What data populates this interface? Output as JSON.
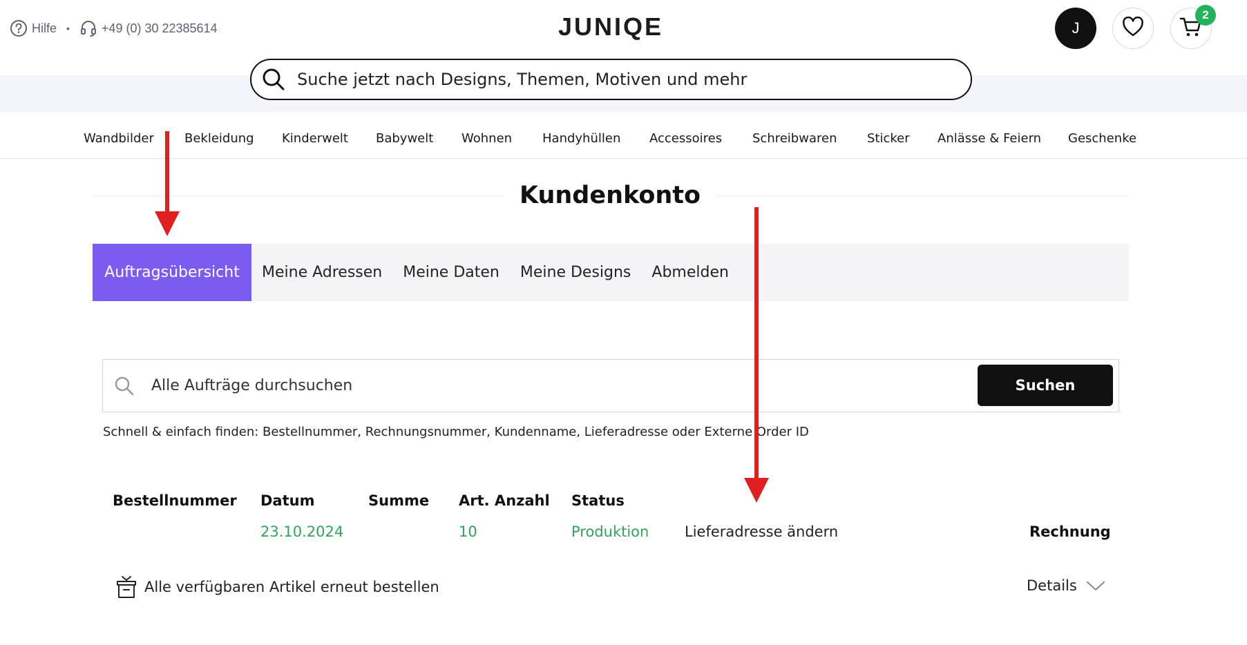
{
  "header": {
    "help_label": "Hilfe",
    "separator": "•",
    "phone": "+49 (0) 30 22385614",
    "logo": "JUNIQE",
    "avatar_initial": "J",
    "cart_count": "2",
    "icons": [
      "help-icon",
      "headset-icon",
      "heart-icon",
      "cart-icon",
      "search-icon"
    ]
  },
  "search": {
    "placeholder": "Suche jetzt nach Designs, Themen, Motiven und mehr"
  },
  "nav": {
    "items": [
      "Wandbilder",
      "Bekleidung",
      "Kinderwelt",
      "Babywelt",
      "Wohnen",
      "Handyhüllen",
      "Accessoires",
      "Schreibwaren",
      "Sticker",
      "Anlässe & Feiern",
      "Geschenke"
    ]
  },
  "account": {
    "title": "Kundenkonto",
    "tabs": [
      "Auftragsübersicht",
      "Meine Adressen",
      "Meine Daten",
      "Meine Designs",
      "Abmelden"
    ],
    "active_tab": "Auftragsübersicht",
    "accent_color": "#7c5cf0"
  },
  "orders": {
    "search_placeholder": "Alle Aufträge durchsuchen",
    "search_button": "Suchen",
    "hint": "Schnell & einfach finden: Bestellnummer, Rechnungsnummer, Kundenname, Lieferadresse oder Externe Order ID",
    "columns": [
      "Bestellnummer",
      "Datum",
      "Summe",
      "Art. Anzahl",
      "Status"
    ],
    "row": {
      "order_number": "",
      "date": "23.10.2024",
      "sum": "",
      "item_count": "10",
      "status": "Produktion",
      "change_address": "Lieferadresse ändern",
      "invoice": "Rechnung"
    },
    "reorder_label": "Alle verfügbaren Artikel erneut bestellen",
    "details_label": "Details",
    "status_color": "#2fa45c"
  },
  "annotations": {
    "arrow_color": "#e02020"
  }
}
